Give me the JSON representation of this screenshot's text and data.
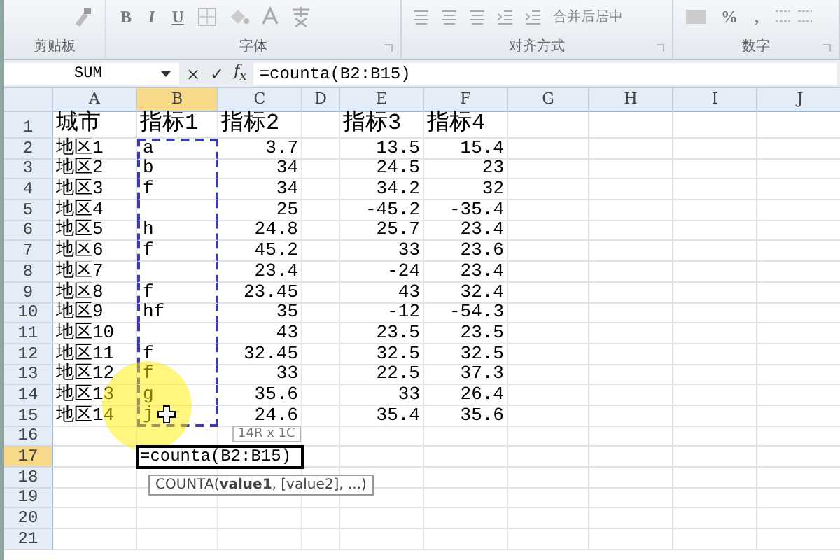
{
  "ribbon": {
    "groups": [
      {
        "kind": "clipboard",
        "label": "剪贴板"
      },
      {
        "kind": "font",
        "label": "字体",
        "buttons": [
          "B",
          "I",
          "U"
        ]
      },
      {
        "kind": "alignment",
        "label": "对齐方式",
        "merge_button": "合并后居中"
      },
      {
        "kind": "number",
        "label": "数字",
        "buttons": [
          "%",
          ","
        ]
      }
    ]
  },
  "formula_bar": {
    "name_box": "SUM",
    "cancel": "×",
    "enter": "✓",
    "function_button": "f$_{x}$",
    "formula": "=counta(B2:B15)"
  },
  "sheet": {
    "columns": [
      {
        "label": "A",
        "selected": false,
        "kind": "text"
      },
      {
        "label": "B",
        "selected": true,
        "kind": "text"
      },
      {
        "label": "C",
        "selected": false,
        "kind": "number"
      },
      {
        "label": "D",
        "selected": false,
        "kind": "text"
      },
      {
        "label": "E",
        "selected": false,
        "kind": "number"
      },
      {
        "label": "F",
        "selected": false,
        "kind": "number"
      },
      {
        "label": "G",
        "selected": false,
        "kind": "text"
      },
      {
        "label": "H",
        "selected": false,
        "kind": "text"
      },
      {
        "label": "I",
        "selected": false,
        "kind": "text"
      },
      {
        "label": "J",
        "selected": false,
        "kind": "text"
      }
    ],
    "rows": [
      {
        "header": "1",
        "kind": "title",
        "selected": false,
        "editing": false,
        "marquee": false,
        "cells": {
          "A": "城市",
          "B": "指标1",
          "C": "指标2",
          "E": "指标3",
          "F": "指标4"
        }
      },
      {
        "header": "2",
        "kind": "data",
        "selected": false,
        "editing": false,
        "marquee": true,
        "cells": {
          "A": "地区1",
          "B": "a",
          "C": "3.7",
          "E": "13.5",
          "F": "15.4"
        }
      },
      {
        "header": "3",
        "kind": "data",
        "selected": false,
        "editing": false,
        "marquee": true,
        "cells": {
          "A": "地区2",
          "B": "b",
          "C": "34",
          "E": "24.5",
          "F": "23"
        }
      },
      {
        "header": "4",
        "kind": "data",
        "selected": false,
        "editing": false,
        "marquee": true,
        "cells": {
          "A": "地区3",
          "B": "f",
          "C": "34",
          "E": "34.2",
          "F": "32"
        }
      },
      {
        "header": "5",
        "kind": "data",
        "selected": false,
        "editing": false,
        "marquee": true,
        "cells": {
          "A": "地区4",
          "C": "25",
          "E": "-45.2",
          "F": "-35.4"
        }
      },
      {
        "header": "6",
        "kind": "data",
        "selected": false,
        "editing": false,
        "marquee": true,
        "cells": {
          "A": "地区5",
          "B": "h",
          "C": "24.8",
          "E": "25.7",
          "F": "23.4"
        }
      },
      {
        "header": "7",
        "kind": "data",
        "selected": false,
        "editing": false,
        "marquee": true,
        "cells": {
          "A": "地区6",
          "B": "f",
          "C": "45.2",
          "E": "33",
          "F": "23.6"
        }
      },
      {
        "header": "8",
        "kind": "data",
        "selected": false,
        "editing": false,
        "marquee": true,
        "cells": {
          "A": "地区7",
          "C": "23.4",
          "E": "-24",
          "F": "23.4"
        }
      },
      {
        "header": "9",
        "kind": "data",
        "selected": false,
        "editing": false,
        "marquee": true,
        "cells": {
          "A": "地区8",
          "B": "f",
          "C": "23.45",
          "E": "43",
          "F": "32.4"
        }
      },
      {
        "header": "10",
        "kind": "data",
        "selected": false,
        "editing": false,
        "marquee": true,
        "cells": {
          "A": "地区9",
          "B": "hf",
          "C": "35",
          "E": "-12",
          "F": "-54.3"
        }
      },
      {
        "header": "11",
        "kind": "data",
        "selected": false,
        "editing": false,
        "marquee": true,
        "cells": {
          "A": "地区10",
          "C": "43",
          "E": "23.5",
          "F": "23.5"
        }
      },
      {
        "header": "12",
        "kind": "data",
        "selected": false,
        "editing": false,
        "marquee": true,
        "cells": {
          "A": "地区11",
          "B": "f",
          "C": "32.45",
          "E": "32.5",
          "F": "32.5"
        }
      },
      {
        "header": "13",
        "kind": "data",
        "selected": false,
        "editing": false,
        "marquee": true,
        "cells": {
          "A": "地区12",
          "B": "f",
          "C": "33",
          "E": "22.5",
          "F": "37.3"
        }
      },
      {
        "header": "14",
        "kind": "data",
        "selected": false,
        "editing": false,
        "marquee": true,
        "cells": {
          "A": "地区13",
          "B": "g",
          "C": "35.6",
          "E": "33",
          "F": "26.4"
        }
      },
      {
        "header": "15",
        "kind": "data",
        "selected": false,
        "editing": false,
        "marquee": true,
        "cells": {
          "A": "地区14",
          "B": "j",
          "C": "24.6",
          "E": "35.4",
          "F": "35.6"
        }
      },
      {
        "header": "16",
        "kind": "data",
        "selected": false,
        "editing": false,
        "marquee": false,
        "cells": {}
      },
      {
        "header": "17",
        "kind": "data",
        "selected": true,
        "editing": true,
        "marquee": false,
        "cells": {
          "B": "=counta(B2:B15)"
        }
      },
      {
        "header": "18",
        "kind": "data",
        "selected": false,
        "editing": false,
        "marquee": false,
        "cells": {}
      },
      {
        "header": "19",
        "kind": "data",
        "selected": false,
        "editing": false,
        "marquee": false,
        "cells": {}
      },
      {
        "header": "20",
        "kind": "data",
        "selected": false,
        "editing": false,
        "marquee": false,
        "cells": {}
      },
      {
        "header": "21",
        "kind": "data",
        "selected": false,
        "editing": false,
        "marquee": false,
        "cells": {}
      }
    ],
    "size_tip": "14R x 1C",
    "function_tip": "COUNTA(**value1**, [value2], ...)"
  }
}
